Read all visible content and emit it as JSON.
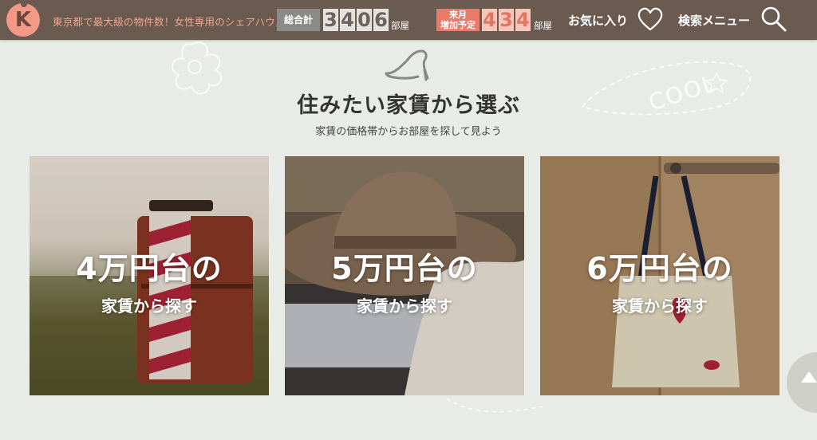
{
  "header": {
    "logo_letter": "K",
    "tagline": "東京都で最大級の物件数！女性専用のシェアハウス",
    "total": {
      "label": "総合計",
      "digits": [
        "3",
        "4",
        "0",
        "6"
      ],
      "unit": "部屋"
    },
    "next_month": {
      "label_line1": "来月",
      "label_line2": "増加予定",
      "digits": [
        "4",
        "3",
        "4"
      ],
      "unit": "部屋"
    },
    "favorites_label": "お気に入り",
    "search_menu_label": "検索メニュー"
  },
  "section": {
    "title": "住みたい家賃から選ぶ",
    "subtitle": "家賃の価格帯からお部屋を探して見よう",
    "decor_text": "COOL"
  },
  "cards": [
    {
      "price": "4万円台の",
      "action": "家賃から探す"
    },
    {
      "price": "5万円台の",
      "action": "家賃から探す"
    },
    {
      "price": "6万円台の",
      "action": "家賃から探す"
    }
  ],
  "colors": {
    "header_bg": "#6b5a50",
    "accent_pink": "#f29a86",
    "page_bg": "#e9ebe7"
  },
  "icons": [
    "logo-icon",
    "heart-icon",
    "search-icon",
    "shoe-icon",
    "scroll-top-icon"
  ]
}
